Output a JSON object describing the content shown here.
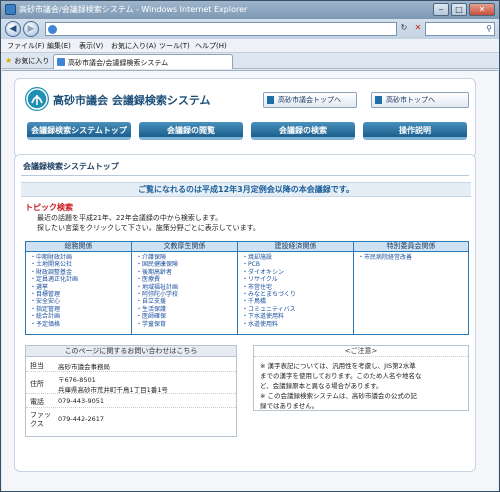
{
  "window": {
    "title": "高砂市議会/会議録検索システム - Windows Internet Explorer",
    "minimize": "‒",
    "maximize": "□",
    "close": "✕"
  },
  "browser": {
    "menus": [
      "ファイル(F)",
      "編集(E)",
      "表示(V)",
      "お気に入り(A)",
      "ツール(T)",
      "ヘルプ(H)"
    ],
    "favorites_label": "お気に入り",
    "tab_title": "高砂市議会/会議録検索システム"
  },
  "header": {
    "site_name": "高砂市議会 会議録検索システム",
    "links": [
      "高砂市議会トップへ",
      "高砂市トップへ"
    ],
    "nav_tabs": [
      "会議録検索システムトップ",
      "会議録の閲覧",
      "会議録の検索",
      "操作説明"
    ]
  },
  "panel": {
    "title": "会議録検索システムトップ",
    "notice": "ご覧になれるのは平成12年3月定例会以降の本会議録です。",
    "topic_heading": "トピック検索",
    "topic_lines": [
      "最近の話題を平成21年、22年会議録の中から検索します。",
      "探したい言葉をクリックして下さい。施策分野ごとに表示しています。"
    ]
  },
  "categories": [
    {
      "title": "総務関係",
      "items": [
        "中期財政計画",
        "土地開発公社",
        "財政調整基金",
        "定員適正化計画",
        "選挙",
        "目標管理",
        "安全安心",
        "指定管理",
        "総合計画",
        "予定価格"
      ]
    },
    {
      "title": "文教厚生関係",
      "items": [
        "介護保険",
        "国民健康保険",
        "後期高齢者",
        "医療費",
        "地域福祉計画",
        "阿弥陀小学校",
        "自立支援",
        "生活保護",
        "医師確保",
        "学童保育"
      ]
    },
    {
      "title": "建設経済関係",
      "items": [
        "焼却施設",
        "PCB",
        "ダイオキシン",
        "リサイクル",
        "市営住宅",
        "みなとまちづくり",
        "千鳥橋",
        "コミュニティバス",
        "下水道使用料",
        "水道使用料"
      ]
    },
    {
      "title": "特別委員会関係",
      "items": [
        "市民病院経営改善"
      ]
    }
  ],
  "contact": {
    "heading": "このページに関するお問い合わせはこちら",
    "rows": [
      {
        "label": "担当",
        "value": "高砂市議会事務局"
      },
      {
        "label": "住所",
        "value": "〒676-8501"
      },
      {
        "label": "",
        "value": "兵庫県高砂市荒井町千鳥1丁目1番1号"
      },
      {
        "label": "電話",
        "value": "079-443-9051"
      },
      {
        "label": "ファックス",
        "value": "079-442-2617"
      }
    ]
  },
  "caution": {
    "heading": "<ご注意>",
    "lines": [
      "※ 漢字表記については、汎用性を考慮し、JIS第2水準",
      "までの漢字を使用しております。このため人名や地名な",
      "ど、会議録原本と異なる場合があります。",
      "※ この会議録検索システムは、高砂市議会の公式の記",
      "録ではありません。"
    ]
  },
  "colors": {
    "accent": "#1b5d8c",
    "notice_text": "#1b5f9a",
    "topic_red": "#c81616",
    "link_blue": "#1a4fa0"
  }
}
